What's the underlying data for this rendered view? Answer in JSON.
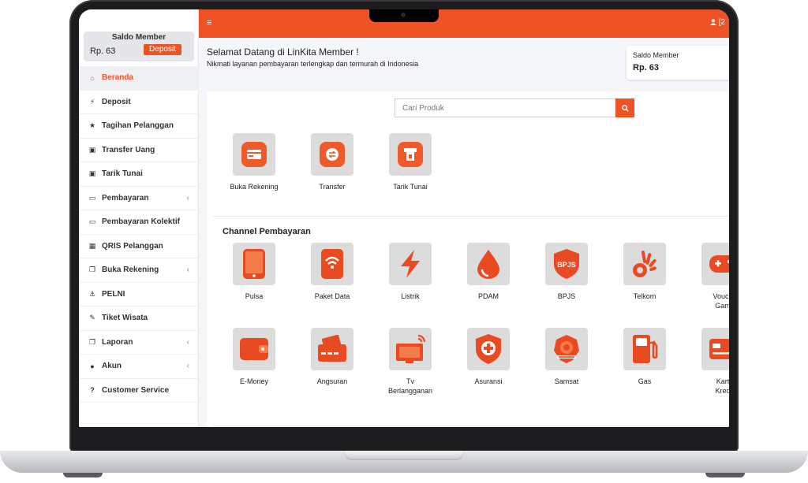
{
  "sidebar": {
    "saldo_title": "Saldo Member",
    "saldo_amount": "Rp. 63",
    "deposit_button": "Deposit",
    "items": [
      {
        "label": "Beranda",
        "icon": "home-icon",
        "active": true
      },
      {
        "label": "Deposit",
        "icon": "plug-icon"
      },
      {
        "label": "Tagihan Pelanggan",
        "icon": "star-icon"
      },
      {
        "label": "Transfer Uang",
        "icon": "money-bill-icon"
      },
      {
        "label": "Tarik Tunai",
        "icon": "money-bill-icon"
      },
      {
        "label": "Pembayaran",
        "icon": "credit-card-icon",
        "chevron": "‹"
      },
      {
        "label": "Pembayaran Kolektif",
        "icon": "credit-card-icon"
      },
      {
        "label": "QRIS Pelanggan",
        "icon": "qrcode-icon"
      },
      {
        "label": "Buka Rekening",
        "icon": "copy-icon",
        "chevron": "‹"
      },
      {
        "label": "PELNI",
        "icon": "anchor-icon"
      },
      {
        "label": "Tiket Wisata",
        "icon": "ticket-icon"
      },
      {
        "label": "Laporan",
        "icon": "copy-icon",
        "chevron": "‹"
      },
      {
        "label": "Akun",
        "icon": "user-icon",
        "chevron": "‹"
      },
      {
        "label": "Customer Service",
        "icon": "question-circle-icon"
      }
    ]
  },
  "topbar": {
    "menu_icon": "≡",
    "user_text": "[2"
  },
  "header": {
    "welcome_title": "Selamat Datang di LinKita Member !",
    "welcome_subtitle": "Nikmati layanan pembayaran terlengkap dan termurah di Indonesia",
    "saldo_card_title": "Saldo Member",
    "saldo_card_amount": "Rp. 63"
  },
  "search": {
    "placeholder": "Cari Produk"
  },
  "quick_actions": [
    {
      "label": "Buka Rekening",
      "icon": "card-icon"
    },
    {
      "label": "Transfer",
      "icon": "exchange-icon"
    },
    {
      "label": "Tarik Tunai",
      "icon": "atm-icon"
    }
  ],
  "channel_title": "Channel Pembayaran",
  "channels_row1": [
    {
      "label": "Pulsa",
      "icon": "phone-icon"
    },
    {
      "label": "Paket Data",
      "icon": "wifi-phone-icon"
    },
    {
      "label": "Listrik",
      "icon": "lightning-icon"
    },
    {
      "label": "PDAM",
      "icon": "water-drop-icon"
    },
    {
      "label": "BPJS",
      "icon": "bpjs-shield-icon",
      "icon_text": "BPJS"
    },
    {
      "label": "Telkom",
      "icon": "telkom-icon"
    },
    {
      "label": "Vouch\nGam",
      "icon": "gamepad-icon"
    }
  ],
  "channels_row2": [
    {
      "label": "E-Money",
      "icon": "wallet-icon"
    },
    {
      "label": "Angsuran",
      "icon": "cash-icon"
    },
    {
      "label": "Tv\nBerlangganan",
      "icon": "tv-icon"
    },
    {
      "label": "Asuransi",
      "icon": "medical-shield-icon"
    },
    {
      "label": "Samsat",
      "icon": "samsat-emblem-icon"
    },
    {
      "label": "Gas",
      "icon": "gas-pump-icon"
    },
    {
      "label": "Kart\nKred",
      "icon": "credit-card-icon"
    }
  ],
  "colors": {
    "accent": "#ee5326",
    "tile_bg": "#dcdcdd",
    "page_bg": "#f4f6f9"
  }
}
